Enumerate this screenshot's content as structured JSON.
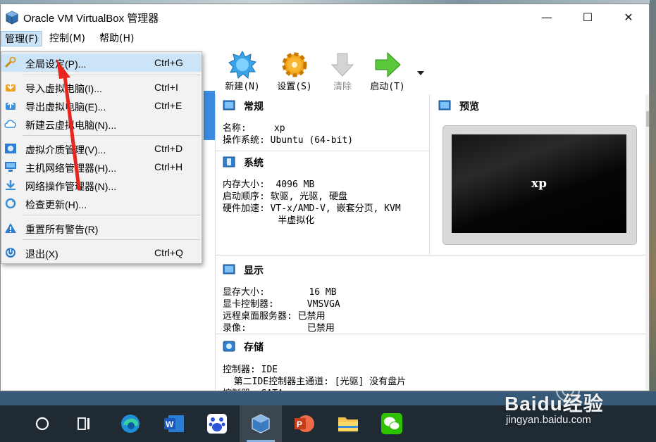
{
  "window": {
    "title": "Oracle VM VirtualBox 管理器",
    "minimize_glyph": "—",
    "maximize_glyph": "☐",
    "close_glyph": "✕"
  },
  "menubar": {
    "items": [
      {
        "label": "管理(F)",
        "active": true
      },
      {
        "label": "控制(M)"
      },
      {
        "label": "帮助(H)"
      }
    ]
  },
  "toolbar": {
    "new_label": "新建(N)",
    "settings_label": "设置(S)",
    "discard_label": "清除",
    "start_label": "启动(T)"
  },
  "dropdown": {
    "items": [
      {
        "label": "全局设定(P)...",
        "shortcut": "Ctrl+G",
        "icon": "wrench-icon",
        "highlight": true
      },
      {
        "label": "导入虚拟电脑(I)...",
        "shortcut": "Ctrl+I",
        "icon": "import-icon"
      },
      {
        "label": "导出虚拟电脑(E)...",
        "shortcut": "Ctrl+E",
        "icon": "export-icon"
      },
      {
        "label": "新建云虚拟电脑(N)...",
        "shortcut": "",
        "icon": "cloud-icon"
      },
      {
        "label": "虚拟介质管理(V)...",
        "shortcut": "Ctrl+D",
        "icon": "media-icon"
      },
      {
        "label": "主机网络管理器(H)...",
        "shortcut": "Ctrl+H",
        "icon": "network-icon"
      },
      {
        "label": "网络操作管理器(N)...",
        "shortcut": "",
        "icon": "download-icon"
      },
      {
        "label": "检查更新(H)...",
        "shortcut": "",
        "icon": "update-icon"
      },
      {
        "label": "重置所有警告(R)",
        "shortcut": "",
        "icon": "warning-icon"
      },
      {
        "label": "退出(X)",
        "shortcut": "Ctrl+Q",
        "icon": "power-icon"
      }
    ]
  },
  "details": {
    "general": {
      "title": "常规",
      "name_row": "名称:     xp",
      "os_row": "操作系统: Ubuntu (64-bit)"
    },
    "system": {
      "title": "系统",
      "memory_row": "内存大小:  4096 MB",
      "boot_row": "启动顺序: 软驱, 光驱, 硬盘",
      "accel_row": "硬件加速: VT-x/AMD-V, 嵌套分页, KVM",
      "accel_row2": "          半虚拟化"
    },
    "preview": {
      "title": "预览",
      "screen_text": "xp"
    },
    "display": {
      "title": "显示",
      "vram_row": "显存大小:        16 MB",
      "controller_row": "显卡控制器:      VMSVGA",
      "rdp_row": "远程桌面服务器: 已禁用",
      "record_row": "录像:           已禁用"
    },
    "storage": {
      "title": "存储",
      "ctrl1_row": "控制器: IDE",
      "ide_row": "  第二IDE控制器主通道: [光驱] 没有盘片",
      "ctrl2_row": "控制器: SATA"
    }
  },
  "watermark": {
    "brand": "Baidu经验",
    "url": "jingyan.baidu.com"
  }
}
